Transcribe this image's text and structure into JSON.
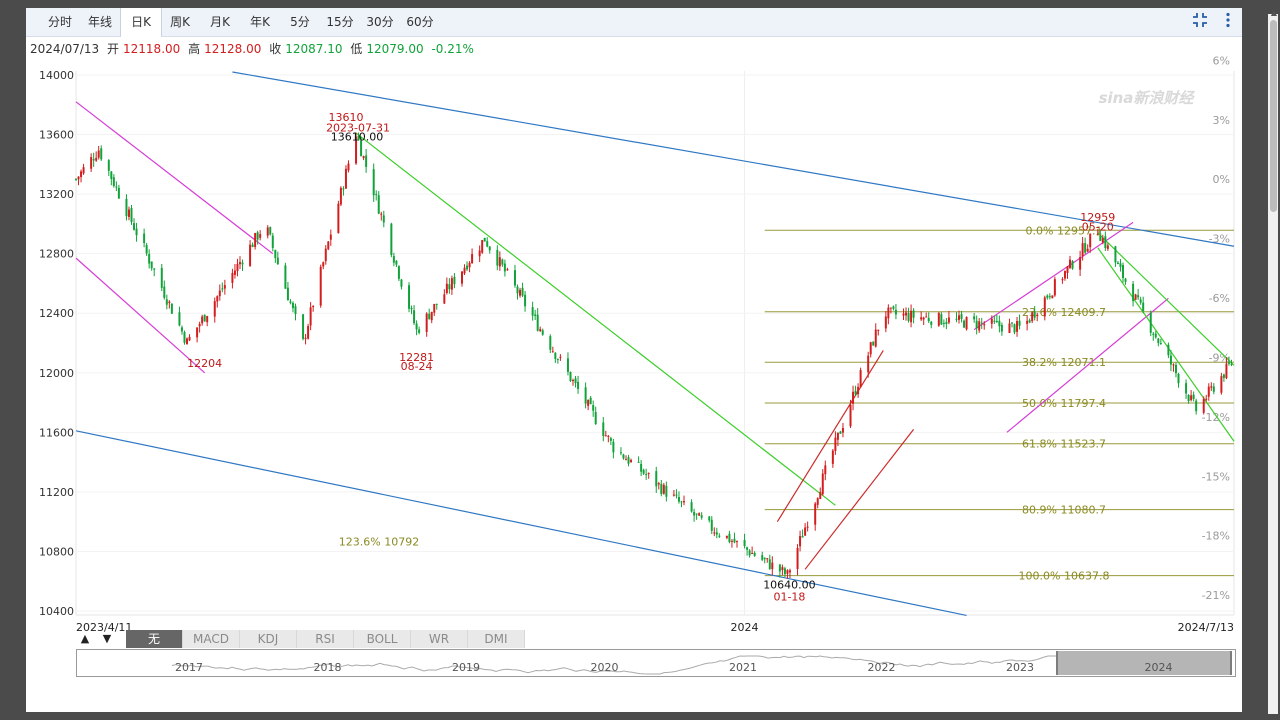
{
  "toolbar": {
    "tabs": [
      "分时",
      "年线",
      "日K",
      "周K",
      "月K",
      "年K",
      "5分",
      "15分",
      "30分",
      "60分"
    ],
    "active_tab": "日K",
    "fullscreen_icon": "collapse-icon",
    "more_icon": "more-vertical-icon"
  },
  "quote": {
    "date": "2024/07/13",
    "open_label": "开",
    "open": "12118.00",
    "high_label": "高",
    "high": "12128.00",
    "close_label": "收",
    "close": "12087.10",
    "low_label": "低",
    "low": "12079.00",
    "change": "-0.21%",
    "colors": {
      "up": "#d21e1e",
      "down": "#11a33a"
    }
  },
  "chart_data": {
    "type": "candlestick",
    "x_start": "2023/4/11",
    "x_end": "2024/7/13",
    "x_mid_label": "2024",
    "y_ticks": [
      "14000",
      "13600",
      "13200",
      "12800",
      "12400",
      "12000",
      "11600",
      "11200",
      "10800",
      "10400"
    ],
    "ylim": [
      10400,
      14000
    ],
    "pct_ticks": [
      "6%",
      "3%",
      "0%",
      "-3%",
      "-6%",
      "-9%",
      "-12%",
      "-15%",
      "-18%",
      "-21%"
    ],
    "key_points": [
      {
        "date": "2023/4/11",
        "value": 13300
      },
      {
        "date": "2023/4/20",
        "value": 13500
      },
      {
        "date": "2023/5/25",
        "value": 12204
      },
      {
        "date": "2023/6/25",
        "value": 13000
      },
      {
        "date": "2023/7/10",
        "value": 12200
      },
      {
        "date": "2023/7/31",
        "value": 13610
      },
      {
        "date": "2023/8/24",
        "value": 12281
      },
      {
        "date": "2023/9/20",
        "value": 12900
      },
      {
        "date": "2023/11/10",
        "value": 11500
      },
      {
        "date": "2023/12/15",
        "value": 11000
      },
      {
        "date": "2024/1/18",
        "value": 10640
      },
      {
        "date": "2024/2/25",
        "value": 12400
      },
      {
        "date": "2024/4/20",
        "value": 12300
      },
      {
        "date": "2024/5/20",
        "value": 12959
      },
      {
        "date": "2024/6/28",
        "value": 11750
      },
      {
        "date": "2024/7/13",
        "value": 12087
      }
    ],
    "fib_levels": [
      {
        "label": "0.0% 12957.1",
        "value": 12957.1
      },
      {
        "label": "23.6% 12409.7",
        "value": 12409.7
      },
      {
        "label": "38.2% 12071.1",
        "value": 12071.1
      },
      {
        "label": "50.0% 11797.4",
        "value": 11797.4
      },
      {
        "label": "61.8% 11523.7",
        "value": 11523.7
      },
      {
        "label": "80.9% 11080.7",
        "value": 11080.7
      },
      {
        "label": "100.0% 10637.8",
        "value": 10637.8
      }
    ],
    "fib_extension_label": "123.6% 10792",
    "annotations": [
      {
        "text": "13610",
        "kind": "red"
      },
      {
        "text": "2023-07-31",
        "kind": "red"
      },
      {
        "text": "13610.00",
        "kind": "black"
      },
      {
        "text": "12204",
        "kind": "red"
      },
      {
        "text": "12281",
        "kind": "red"
      },
      {
        "text": "08-24",
        "kind": "red"
      },
      {
        "text": "12959",
        "kind": "red"
      },
      {
        "text": "05-20",
        "kind": "red"
      },
      {
        "text": "10640.00",
        "kind": "black"
      },
      {
        "text": "01-18",
        "kind": "red"
      }
    ],
    "line_colors": {
      "trend_long": "#2f78c4",
      "channel_magenta": "#d63fd6",
      "channel_green": "#3ccf2a",
      "channel_red": "#cc2b2b",
      "fib": "#9a9a3a"
    }
  },
  "indicators": {
    "arrows": [
      "▲",
      "▼"
    ],
    "buttons": [
      "无",
      "MACD",
      "KDJ",
      "RSI",
      "BOLL",
      "WR",
      "DMI"
    ],
    "active": "无"
  },
  "navigator": {
    "years": [
      "2017",
      "2018",
      "2019",
      "2020",
      "2021",
      "2022",
      "2023",
      "2024"
    ]
  },
  "watermark": "sina新浪财经"
}
